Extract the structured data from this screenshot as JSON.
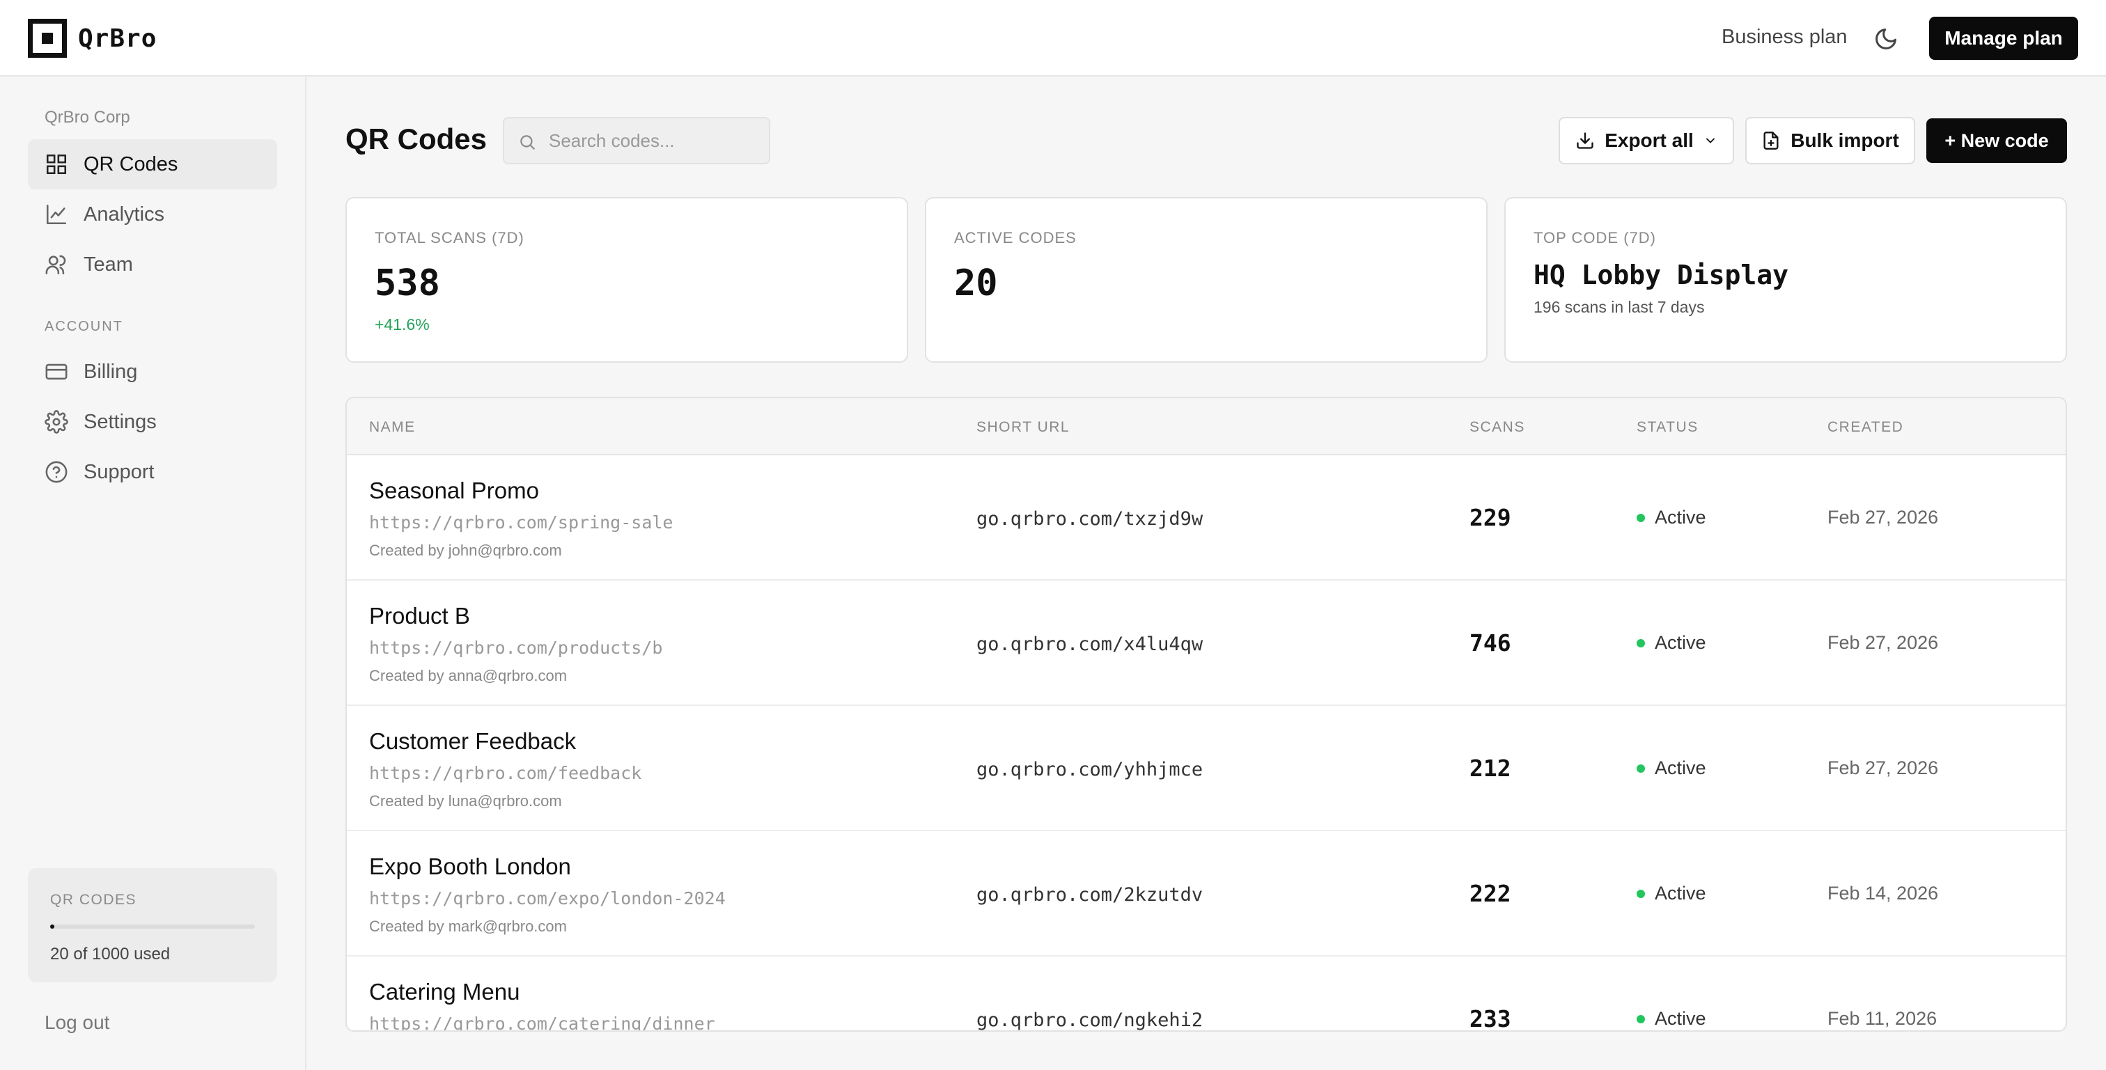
{
  "header": {
    "logo_text": "QrBro",
    "plan_label": "Business plan",
    "theme_icon": "moon-icon",
    "manage_label": "Manage plan"
  },
  "sidebar": {
    "org_name": "QrBro Corp",
    "items": [
      {
        "label": "QR Codes",
        "icon": "grid-icon",
        "active": true
      },
      {
        "label": "Analytics",
        "icon": "chart-icon",
        "active": false
      },
      {
        "label": "Team",
        "icon": "users-icon",
        "active": false
      }
    ],
    "account_label": "ACCOUNT",
    "account_items": [
      {
        "label": "Billing",
        "icon": "credit-card-icon"
      },
      {
        "label": "Settings",
        "icon": "gear-icon"
      },
      {
        "label": "Support",
        "icon": "help-circle-icon"
      }
    ],
    "usage": {
      "label": "QR CODES",
      "used": 20,
      "limit": 1000,
      "fraction": 0.02,
      "text": "20 of 1000 used"
    },
    "logout_label": "Log out"
  },
  "main": {
    "title": "QR Codes",
    "search_placeholder": "Search codes...",
    "export_label": "Export all",
    "import_label": "Bulk import",
    "new_label": "+ New code"
  },
  "stats": {
    "total_scans": {
      "label": "TOTAL SCANS (7D)",
      "value": "538",
      "change": "+41.6%"
    },
    "active_codes": {
      "label": "ACTIVE CODES",
      "value": "20"
    },
    "top_code": {
      "label": "TOP CODE (7D)",
      "name": "HQ Lobby Display",
      "sub": "196 scans in last 7 days"
    }
  },
  "table": {
    "columns": [
      "NAME",
      "SHORT URL",
      "SCANS",
      "STATUS",
      "CREATED"
    ],
    "rows": [
      {
        "name": "Seasonal Promo",
        "url": "https://qrbro.com/spring-sale",
        "creator": "Created by john@qrbro.com",
        "short_url": "go.qrbro.com/txzjd9w",
        "scans": "229",
        "status": "Active",
        "created": "Feb 27, 2026"
      },
      {
        "name": "Product B",
        "url": "https://qrbro.com/products/b",
        "creator": "Created by anna@qrbro.com",
        "short_url": "go.qrbro.com/x4lu4qw",
        "scans": "746",
        "status": "Active",
        "created": "Feb 27, 2026"
      },
      {
        "name": "Customer Feedback",
        "url": "https://qrbro.com/feedback",
        "creator": "Created by luna@qrbro.com",
        "short_url": "go.qrbro.com/yhhjmce",
        "scans": "212",
        "status": "Active",
        "created": "Feb 27, 2026"
      },
      {
        "name": "Expo Booth London",
        "url": "https://qrbro.com/expo/london-2024",
        "creator": "Created by mark@qrbro.com",
        "short_url": "go.qrbro.com/2kzutdv",
        "scans": "222",
        "status": "Active",
        "created": "Feb 14, 2026"
      },
      {
        "name": "Catering Menu",
        "url": "https://qrbro.com/catering/dinner",
        "creator": "",
        "short_url": "go.qrbro.com/ngkehi2",
        "scans": "233",
        "status": "Active",
        "created": "Feb 11, 2026"
      }
    ]
  },
  "colors": {
    "accent": "#0b0b0b",
    "positive": "#22a35a",
    "status_active": "#22c55e"
  }
}
